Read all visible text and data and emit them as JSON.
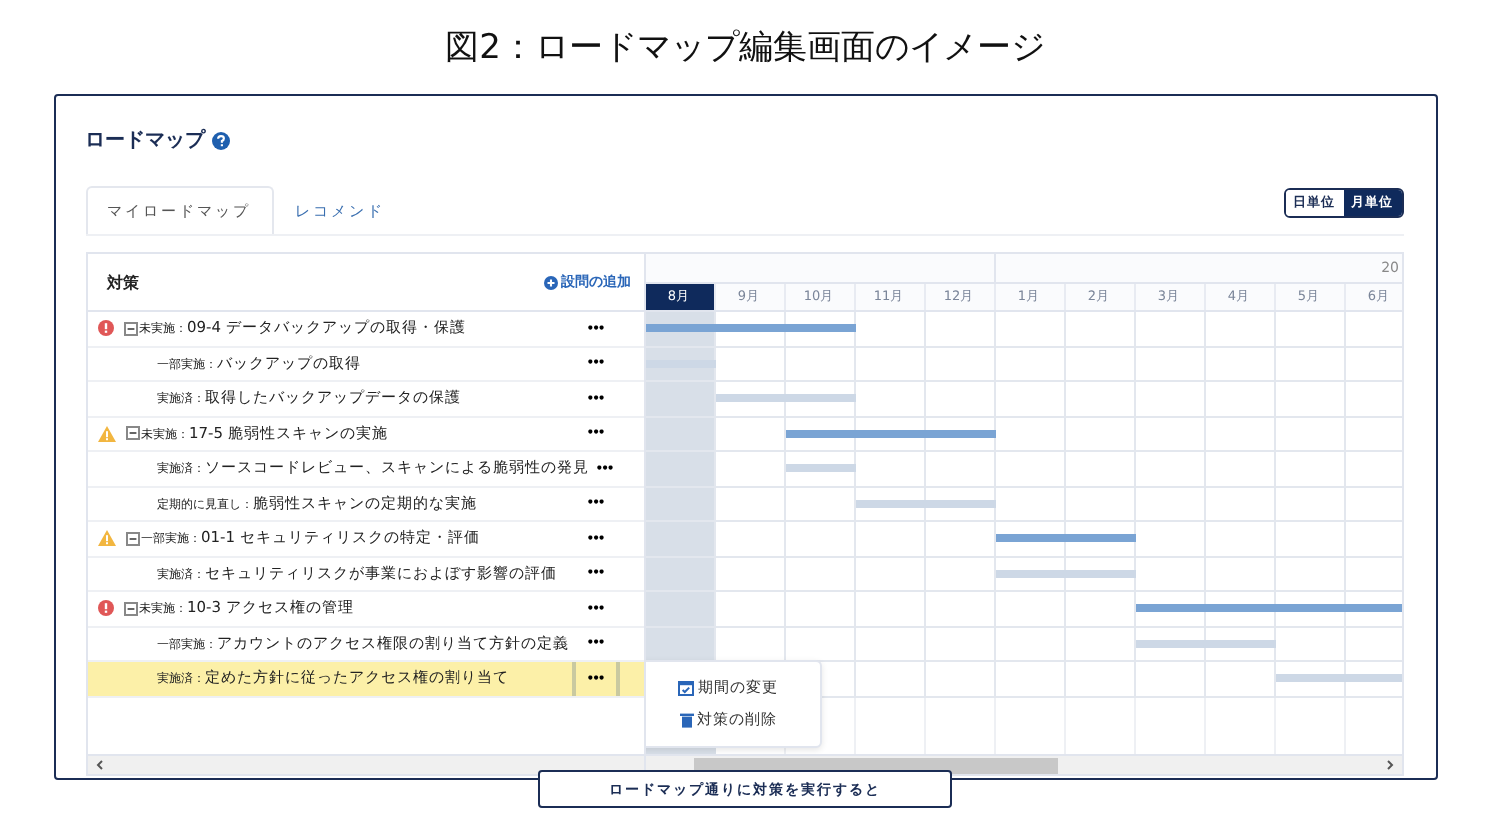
{
  "caption": "図2：ロードマップ編集画面のイメージ",
  "page": {
    "title": "ロードマップ"
  },
  "tabs": [
    {
      "label": "マイロードマップ",
      "selected": true
    },
    {
      "label": "レコメンド",
      "selected": false
    }
  ],
  "scale_toggle": [
    {
      "label": "日単位",
      "selected": false
    },
    {
      "label": "月単位",
      "selected": true
    }
  ],
  "table": {
    "column_title": "対策",
    "add_link": "設問の追加",
    "more_label": "•••",
    "year_label": "20",
    "months": [
      {
        "label": "8月",
        "selected": true
      },
      {
        "label": "9月",
        "selected": false
      },
      {
        "label": "10月",
        "selected": false
      },
      {
        "label": "11月",
        "selected": false
      },
      {
        "label": "12月",
        "selected": false
      },
      {
        "label": "1月",
        "selected": false
      },
      {
        "label": "2月",
        "selected": false
      },
      {
        "label": "3月",
        "selected": false
      },
      {
        "label": "4月",
        "selected": false
      },
      {
        "label": "5月",
        "selected": false
      },
      {
        "label": "6月",
        "selected": false
      }
    ],
    "items": [
      {
        "kind": "error",
        "expanded": true,
        "status": "未実施：",
        "title": "09-4 データバックアップの取得・保護",
        "selected": false,
        "bar": [
          true,
          true,
          true,
          false,
          false,
          false,
          false,
          false,
          false,
          false,
          false
        ],
        "children": [
          {
            "status": "一部実施：",
            "title": "バックアップの取得",
            "selected": false,
            "bar": [
              true,
              false,
              false,
              false,
              false,
              false,
              false,
              false,
              false,
              false,
              false
            ]
          },
          {
            "status": "実施済：",
            "title": "取得したバックアップデータの保護",
            "selected": false,
            "bar": [
              false,
              true,
              true,
              false,
              false,
              false,
              false,
              false,
              false,
              false,
              false
            ]
          }
        ]
      },
      {
        "kind": "warning",
        "expanded": true,
        "status": "未実施：",
        "title": "17-5 脆弱性スキャンの実施",
        "selected": false,
        "bar": [
          false,
          false,
          true,
          true,
          true,
          false,
          false,
          false,
          false,
          false,
          false
        ],
        "children": [
          {
            "status": "実施済：",
            "title": "ソースコードレビュー、スキャンによる脆弱性の発見",
            "selected": false,
            "bar": [
              false,
              false,
              true,
              false,
              false,
              false,
              false,
              false,
              false,
              false,
              false
            ]
          },
          {
            "status": "定期的に見直し：",
            "title": "脆弱性スキャンの定期的な実施",
            "selected": false,
            "bar": [
              false,
              false,
              false,
              true,
              true,
              false,
              false,
              false,
              false,
              false,
              false
            ]
          }
        ]
      },
      {
        "kind": "warning",
        "expanded": true,
        "status": "一部実施：",
        "title": "01-1 セキュリティリスクの特定・評価",
        "selected": false,
        "bar": [
          false,
          false,
          false,
          false,
          false,
          true,
          true,
          false,
          false,
          false,
          false
        ],
        "children": [
          {
            "status": "実施済：",
            "title": "セキュリティリスクが事業におよぼす影響の評価",
            "selected": false,
            "bar": [
              false,
              false,
              false,
              false,
              false,
              true,
              true,
              false,
              false,
              false,
              false
            ]
          }
        ]
      },
      {
        "kind": "error",
        "expanded": true,
        "status": "未実施：",
        "title": "10-3 アクセス権の管理",
        "selected": false,
        "bar": [
          false,
          false,
          false,
          false,
          false,
          false,
          false,
          true,
          true,
          true,
          true
        ],
        "children": [
          {
            "status": "一部実施：",
            "title": "アカウントのアクセス権限の割り当て方針の定義",
            "selected": false,
            "bar": [
              false,
              false,
              false,
              false,
              false,
              false,
              false,
              true,
              true,
              false,
              false
            ]
          },
          {
            "status": "実施済：",
            "title": "定めた方針に従ったアクセス権の割り当て",
            "selected": true,
            "bar": [
              false,
              false,
              false,
              false,
              false,
              false,
              false,
              false,
              false,
              true,
              true
            ]
          }
        ]
      }
    ]
  },
  "context_menu": [
    {
      "kind": "calendar",
      "label": "期間の変更"
    },
    {
      "kind": "trash",
      "label": "対策の削除"
    }
  ],
  "action_button": "ロードマップ通りに対策を実行すると"
}
